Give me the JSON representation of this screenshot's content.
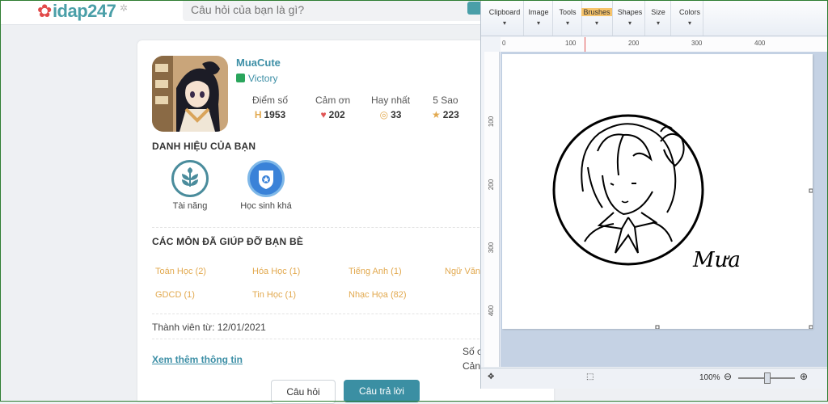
{
  "site": {
    "logo_text": "idap247",
    "search_placeholder": "Câu hỏi của bạn là gì?"
  },
  "profile": {
    "username": "MuaCute",
    "rank": "Victory",
    "stats": [
      {
        "label": "Điểm số",
        "value": "1953",
        "icon": "H"
      },
      {
        "label": "Cảm ơn",
        "value": "202",
        "icon": "♥"
      },
      {
        "label": "Hay nhất",
        "value": "33",
        "icon": "🏅"
      },
      {
        "label": "5 Sao",
        "value": "223",
        "icon": "★"
      }
    ],
    "titles_heading": "DANH HIỆU CỦA BẠN",
    "titles": [
      {
        "label": "Tài năng"
      },
      {
        "label": "Học sinh khá"
      }
    ],
    "subjects_heading": "CÁC MÔN ĐÃ GIÚP ĐỠ BẠN BÈ",
    "subjects": [
      {
        "label": "Toán Học (2)"
      },
      {
        "label": "Hóa Học (1)"
      },
      {
        "label": "Tiếng Anh (1)"
      },
      {
        "label": "Ngữ Văn"
      },
      {
        "label": "GDCD (1)"
      },
      {
        "label": "Tin Học (1)"
      },
      {
        "label": "Nhạc Họa (82)"
      }
    ],
    "member_since": "Thành viên từ: 12/01/2021",
    "more_info": "Xem thêm thông tin",
    "side_text_1": "Số c",
    "side_text_2": "Cản",
    "btn_questions": "Câu hỏi",
    "btn_answers": "Câu trả lời"
  },
  "paint": {
    "groups": [
      {
        "label": "Clipboard"
      },
      {
        "label": "Image"
      },
      {
        "label": "Tools"
      },
      {
        "label": "Brushes"
      },
      {
        "label": "Shapes"
      },
      {
        "label": "Size"
      },
      {
        "label": "Colors"
      }
    ],
    "ruler_top": [
      "0",
      "100",
      "200",
      "300",
      "400"
    ],
    "ruler_left": [
      "100",
      "200",
      "300",
      "400"
    ],
    "signature": "Mưa",
    "zoom": "100%"
  }
}
